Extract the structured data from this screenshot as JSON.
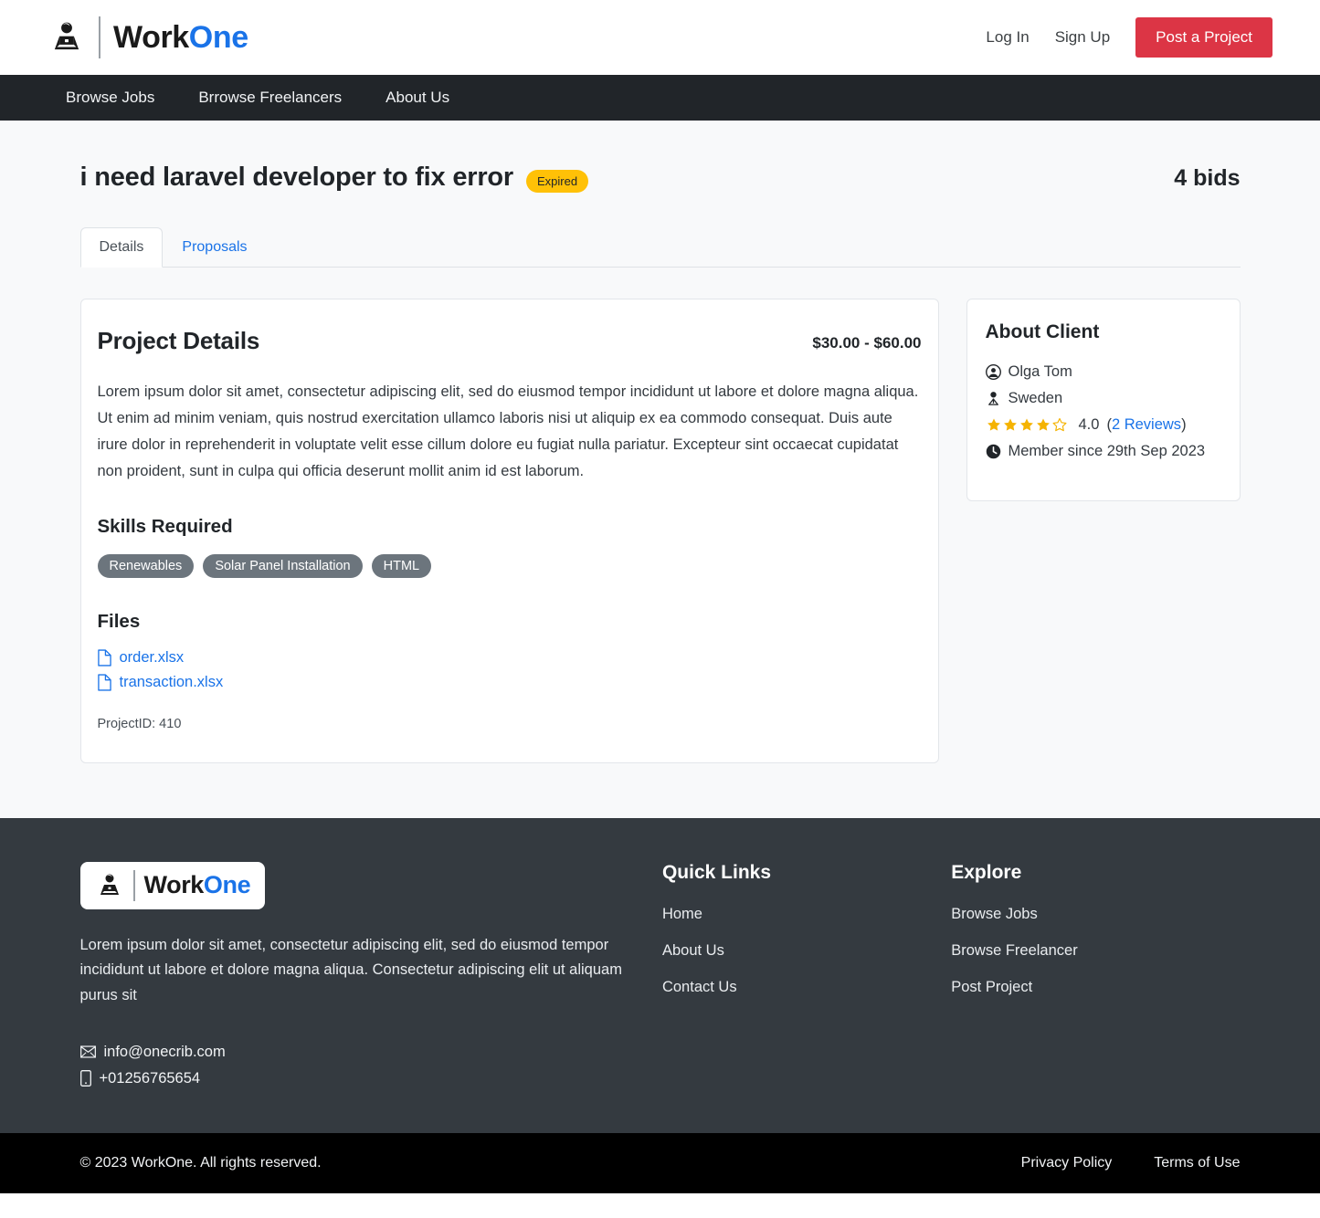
{
  "header": {
    "logo": {
      "icon": "person-laptop-icon",
      "text_primary": "Work",
      "text_accent": "One"
    },
    "login_label": "Log In",
    "signup_label": "Sign Up",
    "post_project_label": "Post a Project",
    "post_project_color": "#dc3545"
  },
  "nav": {
    "items": [
      {
        "label": "Browse Jobs"
      },
      {
        "label": "Brrowse Freelancers"
      },
      {
        "label": "About Us"
      }
    ],
    "background_color": "#212529"
  },
  "project": {
    "title": "i need laravel developer to fix error",
    "status_badge": "Expired",
    "status_badge_color": "#ffc107",
    "bids_count": "4 bids",
    "tabs": [
      {
        "label": "Details",
        "active": true
      },
      {
        "label": "Proposals",
        "active": false
      }
    ],
    "details": {
      "section_title": "Project Details",
      "price_range": "$30.00 - $60.00",
      "description": "Lorem ipsum dolor sit amet, consectetur adipiscing elit, sed do eiusmod tempor incididunt ut labore et dolore magna aliqua. Ut enim ad minim veniam, quis nostrud exercitation ullamco laboris nisi ut aliquip ex ea commodo consequat. Duis aute irure dolor in reprehenderit in voluptate velit esse cillum dolore eu fugiat nulla pariatur. Excepteur sint occaecat cupidatat non proident, sunt in culpa qui officia deserunt mollit anim id est laborum.",
      "skills_title": "Skills Required",
      "skills": [
        {
          "label": "Renewables"
        },
        {
          "label": "Solar Panel Installation"
        },
        {
          "label": "HTML"
        }
      ],
      "skill_pill_color": "#6c757d",
      "files_title": "Files",
      "files": [
        {
          "name": "order.xlsx",
          "icon": "file-icon"
        },
        {
          "name": "transaction.xlsx",
          "icon": "file-icon"
        }
      ],
      "project_id": "ProjectID: 410"
    }
  },
  "client": {
    "card_title": "About Client",
    "name": "Olga Tom",
    "name_icon": "person-circle-icon",
    "country": "Sweden",
    "country_icon": "person-location-icon",
    "rating_value": "4.0",
    "rating_stars_filled": 4,
    "rating_stars_total": 5,
    "star_color": "#f5b301",
    "reviews_label": "2 Reviews",
    "member_since": "Member since 29th Sep 2023",
    "member_icon": "clock-icon"
  },
  "footer": {
    "description": "Lorem ipsum dolor sit amet, consectetur adipiscing elit, sed do eiusmod tempor incididunt ut labore et dolore magna aliqua. Consectetur adipiscing elit ut aliquam purus sit",
    "email": "info@onecrib.com",
    "email_icon": "envelope-icon",
    "phone": "+01256765654",
    "phone_icon": "phone-icon",
    "quick_links_title": "Quick Links",
    "quick_links": [
      {
        "label": "Home"
      },
      {
        "label": "About Us"
      },
      {
        "label": "Contact Us"
      }
    ],
    "explore_title": "Explore",
    "explore_links": [
      {
        "label": "Browse Jobs"
      },
      {
        "label": "Browse Freelancer"
      },
      {
        "label": "Post Project"
      }
    ],
    "copyright": "© 2023 WorkOne. All rights reserved.",
    "privacy_label": "Privacy Policy",
    "terms_label": "Terms of Use",
    "background_color": "#343a40"
  }
}
